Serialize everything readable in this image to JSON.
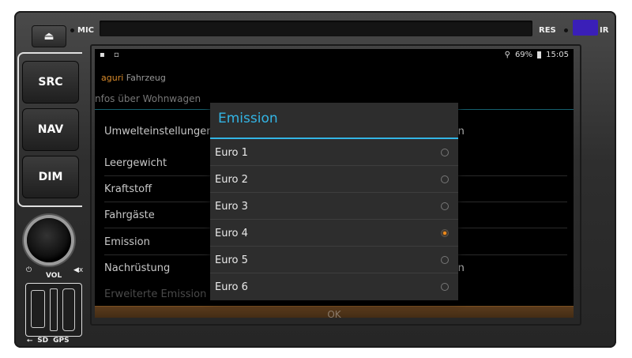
{
  "device": {
    "eject_symbol": "⏏",
    "mic_label": "MIC",
    "res_label": "RES",
    "ir_label": "IR",
    "buttons": [
      "SRC",
      "NAV",
      "DIM"
    ],
    "vol_label": "VOL",
    "power_symbol": "⏻",
    "mute_symbol": "◀x",
    "bottom_labels": [
      "⭠",
      "SD",
      "GPS"
    ]
  },
  "status_bar": {
    "left_icons": "▪ ▫",
    "location_symbol": "⚲",
    "battery": "69%",
    "time": "15:05"
  },
  "app": {
    "brand_colored": "aguri",
    "brand_gray": "Fahrzeug",
    "section_title": "nfos über Wohnwagen",
    "rows": [
      {
        "label": "Umwelteinstellungen",
        "value": "in"
      },
      {
        "label": "Leergewicht",
        "value": ""
      },
      {
        "label": "Kraftstoff",
        "value": ""
      },
      {
        "label": "Fahrgäste",
        "value": ""
      },
      {
        "label": "Emission",
        "value": ""
      },
      {
        "label": "Nachrüstung",
        "value": "in"
      },
      {
        "label": "Erweiterte Emission",
        "value": ""
      }
    ],
    "ok_label": "OK"
  },
  "dialog": {
    "title": "Emission",
    "options": [
      {
        "label": "Euro 1",
        "checked": false
      },
      {
        "label": "Euro 2",
        "checked": false
      },
      {
        "label": "Euro 3",
        "checked": false
      },
      {
        "label": "Euro 4",
        "checked": true
      },
      {
        "label": "Euro 5",
        "checked": false
      },
      {
        "label": "Euro 6",
        "checked": false
      }
    ]
  },
  "colors": {
    "accent_blue": "#33b5e5",
    "radio_selected": "#f08a1a",
    "brand_orange": "#d98a2a"
  }
}
